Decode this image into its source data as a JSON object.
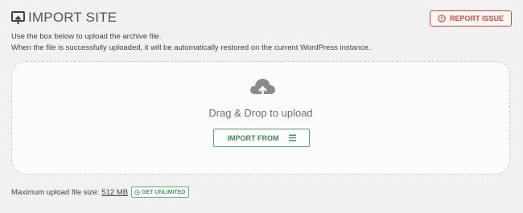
{
  "header": {
    "title": "IMPORT SITE",
    "title_icon": "import-site-icon",
    "report_label": "REPORT ISSUE",
    "report_icon": "alert-circle-icon"
  },
  "description": {
    "line1": "Use the box below to upload the archive file.",
    "line2": "When the file is successfully uploaded, it will be automatically restored on the current WordPress instance."
  },
  "dropzone": {
    "icon": "cloud-upload-icon",
    "text": "Drag & Drop to upload",
    "import_label": "IMPORT FROM",
    "import_icon": "menu-icon"
  },
  "footer": {
    "max_label": "Maximum upload file size:",
    "max_size": "512 MB",
    "unlimited_label": "GET UNLIMITED",
    "unlimited_icon": "clock-icon"
  },
  "colors": {
    "report": "#c0533f",
    "import": "#4ea56b",
    "background": "#f1f1f1"
  }
}
